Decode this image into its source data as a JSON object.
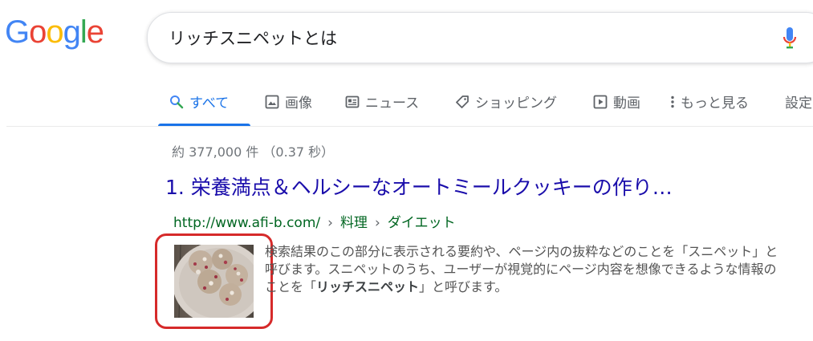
{
  "logo": {
    "letters": [
      {
        "char": "G",
        "color": "#4285F4"
      },
      {
        "char": "o",
        "color": "#EA4335"
      },
      {
        "char": "o",
        "color": "#FBBC05"
      },
      {
        "char": "g",
        "color": "#4285F4"
      },
      {
        "char": "l",
        "color": "#34A853"
      },
      {
        "char": "e",
        "color": "#EA4335"
      }
    ]
  },
  "search": {
    "query": "リッチスニペットとは",
    "mic_icon": "microphone-icon"
  },
  "tabs": [
    {
      "label": "すべて",
      "icon": "search-icon",
      "active": true
    },
    {
      "label": "画像",
      "icon": "image-icon",
      "active": false
    },
    {
      "label": "ニュース",
      "icon": "news-icon",
      "active": false
    },
    {
      "label": "ショッピング",
      "icon": "tag-icon",
      "active": false
    },
    {
      "label": "動画",
      "icon": "play-icon",
      "active": false
    },
    {
      "label": "もっと見る",
      "icon": "more-vert-icon",
      "active": false
    },
    {
      "label": "設定",
      "icon": "",
      "active": false
    }
  ],
  "colors": {
    "accent": "#1a73e8",
    "link": "#1a0dab",
    "url": "#006621",
    "highlight_frame": "#d62a2a"
  },
  "results": {
    "stats": "約 377,000 件 （0.37 秒）",
    "title": "1. 栄養満点＆ヘルシーなオートミールクッキーの作り…",
    "url": "http://www.afi-b.com/",
    "breadcrumb_1": "料理",
    "breadcrumb_2": "ダイエット",
    "breadcrumb_sep": "›",
    "snippet_part1": "検索結果のこの部分に表示される要約や、ページ内の抜粋などのことを「スニペット」と呼びます。スニペットのうち、ユーザーが視覚的にページ内容を想像できるような情報のことを「",
    "snippet_bold": "リッチスニペット",
    "snippet_part2": "」と呼びます。"
  }
}
